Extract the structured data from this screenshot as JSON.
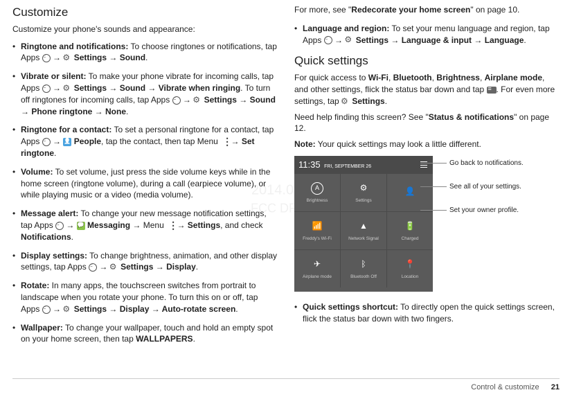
{
  "watermark": {
    "line1": "2014.08.07",
    "line2": "FCC DRAFT"
  },
  "left": {
    "heading": "Customize",
    "intro": "Customize your phone's sounds and appearance:",
    "items": [
      {
        "lead": "Ringtone and notifications:",
        "rest": " To choose ringtones or notifications, tap Apps ",
        "tail1": " → ",
        "tail2": " Settings → Sound",
        "tail3": "."
      },
      {
        "lead": "Vibrate or silent:",
        "rest": " To make your phone vibrate for incoming calls, tap Apps ",
        "seg1": " → ",
        "seg2": " Settings → Sound → Vibrate when ringing",
        "seg3": ". To turn off ringtones for incoming calls, tap Apps ",
        "seg4": " → ",
        "seg5": " Settings → Sound → Phone ringtone → None",
        "seg6": "."
      },
      {
        "lead": "Ringtone for a contact:",
        "rest": " To set a personal ringtone for a contact, tap Apps ",
        "seg1": " → ",
        "seg2": " People",
        "seg3": ", tap the contact, then tap Menu ",
        "seg4": " → ",
        "seg5": "Set ringtone",
        "seg6": "."
      },
      {
        "lead": "Volume:",
        "rest": " To set volume, just press the side volume keys while in the home screen (ringtone volume), during a call (earpiece volume), or while playing music or a video (media volume)."
      },
      {
        "lead": "Message alert:",
        "rest": " To change your new message notification settings, tap Apps ",
        "seg1": " → ",
        "seg2": " Messaging",
        "seg3": " → Menu ",
        "seg4": " → ",
        "seg5": "Settings",
        "seg6": ", and check ",
        "seg7": "Notifications",
        "seg8": "."
      },
      {
        "lead": "Display settings:",
        "rest": " To change brightness, animation, and other display settings, tap Apps ",
        "seg1": " → ",
        "seg2": " Settings → Display",
        "seg3": "."
      },
      {
        "lead": "Rotate:",
        "rest": " In many apps, the touchscreen switches from portrait to landscape when you rotate your phone. To turn this on or off, tap Apps ",
        "seg1": " → ",
        "seg2": " Settings → Display → Auto-rotate screen",
        "seg3": "."
      },
      {
        "lead": "Wallpaper:",
        "rest": " To change your wallpaper, touch and hold an empty spot on your home screen, then tap ",
        "seg1": "WALLPAPERS",
        "seg2": "."
      }
    ]
  },
  "right": {
    "formore_a": "For more, see \"",
    "formore_b": "Redecorate your home screen",
    "formore_c": "\" on page 10.",
    "lang": {
      "lead": "Language and region:",
      "rest": " To set your menu language and region, tap Apps ",
      "seg1": " → ",
      "seg2": " Settings → Language & input → Language",
      "seg3": "."
    },
    "qs_heading": "Quick settings",
    "qs_p1a": "For quick access to ",
    "qs_p1b": "Wi-Fi",
    "qs_p1c": ", ",
    "qs_p1d": "Bluetooth",
    "qs_p1e": ", ",
    "qs_p1f": "Brightness",
    "qs_p1g": ", ",
    "qs_p1h": "Airplane mode",
    "qs_p1i": ", and other settings, flick the status bar down and tap ",
    "qs_p1j": ". For even more settings, tap ",
    "qs_p1k": " Settings",
    "qs_p1l": ".",
    "qs_p2a": "Need help finding this screen? See \"",
    "qs_p2b": "Status & notifications",
    "qs_p2c": "\" on page 12.",
    "qs_note_label": "Note:",
    "qs_note": " Your quick settings may look a little different.",
    "screenshot": {
      "time": "11:35",
      "date": "FRI, SEPTEMBER 26",
      "tiles": [
        {
          "icon": "A",
          "label": "Brightness",
          "circle": true
        },
        {
          "icon": "⚙",
          "label": "Settings"
        },
        {
          "icon": "👤",
          "label": ""
        },
        {
          "icon": "📶",
          "label": "Freddy's Wi-Fi"
        },
        {
          "icon": "▲",
          "label": "Network Signal"
        },
        {
          "icon": "🔋",
          "label": "Charged"
        },
        {
          "icon": "✈",
          "label": "Airplane mode"
        },
        {
          "icon": "ᛒ",
          "label": "Bluetooth Off"
        },
        {
          "icon": "📍",
          "label": "Location"
        }
      ]
    },
    "callouts": [
      "Go back to notifications.",
      "See all of your settings.",
      "Set your owner profile."
    ],
    "shortcut": {
      "lead": "Quick settings shortcut:",
      "rest": " To directly open the quick settings screen, flick the status bar down with two fingers."
    }
  },
  "footer": {
    "section": "Control & customize",
    "page": "21"
  }
}
